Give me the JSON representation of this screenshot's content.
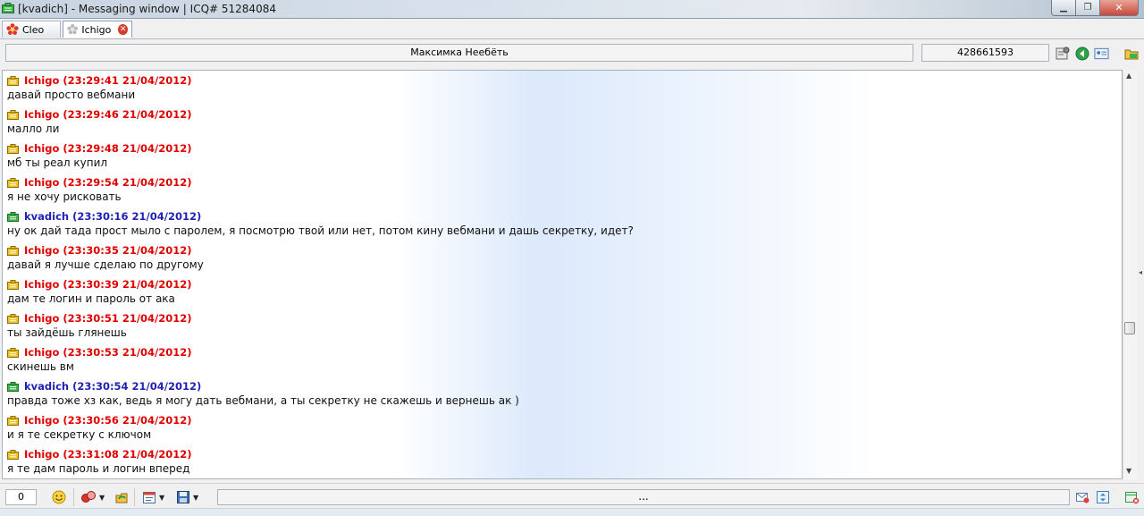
{
  "window": {
    "title": "[kvadich] - Messaging window | ICQ# 51284084",
    "minimize_glyph": "▁",
    "maximize_glyph": "❐",
    "close_glyph": "✕"
  },
  "tabs": [
    {
      "label": "Cleo",
      "icon": "flower-icon-red",
      "active": false
    },
    {
      "label": "Ichigo",
      "icon": "flower-icon-gray",
      "active": true,
      "close_icon": "close-icon"
    }
  ],
  "contact": {
    "display_name": "Максимка Неебёть",
    "uin": "428661593",
    "icons": [
      "settings-icon",
      "online-status-icon",
      "user-details-icon",
      "history-icon"
    ]
  },
  "colors": {
    "their_nick": "#e00000",
    "my_nick": "#1f22b3",
    "their_badge": "#f0c419",
    "my_badge": "#3cb34a"
  },
  "messages": [
    {
      "sender": "them",
      "header": "Ichigo (23:29:41 21/04/2012)",
      "text": "давай просто вебмани"
    },
    {
      "sender": "them",
      "header": "Ichigo (23:29:46 21/04/2012)",
      "text": "малло ли"
    },
    {
      "sender": "them",
      "header": "Ichigo (23:29:48 21/04/2012)",
      "text": "мб ты реал купил"
    },
    {
      "sender": "them",
      "header": "Ichigo (23:29:54 21/04/2012)",
      "text": "я не хочу рисковать"
    },
    {
      "sender": "me",
      "header": "kvadich (23:30:16 21/04/2012)",
      "text": "ну ок дай тада прост мыло с паролем, я посмотрю твой или нет, потом кину вебмани и дашь секретку, идет?"
    },
    {
      "sender": "them",
      "header": "Ichigo (23:30:35 21/04/2012)",
      "text": "давай я лучше сделаю по другому"
    },
    {
      "sender": "them",
      "header": "Ichigo (23:30:39 21/04/2012)",
      "text": "дам те логин и пароль от ака"
    },
    {
      "sender": "them",
      "header": "Ichigo (23:30:51 21/04/2012)",
      "text": "ты зайдёшь глянешь"
    },
    {
      "sender": "them",
      "header": "Ichigo (23:30:53 21/04/2012)",
      "text": "скинешь вм"
    },
    {
      "sender": "me",
      "header": "kvadich (23:30:54 21/04/2012)",
      "text": "правда тоже хз как, ведь я могу дать вебмани, а ты секретку не скажешь и вернешь ак )"
    },
    {
      "sender": "them",
      "header": "Ichigo (23:30:56 21/04/2012)",
      "text": "и я те секретку с ключом"
    },
    {
      "sender": "them",
      "header": "Ichigo (23:31:08 21/04/2012)",
      "text": "я те дам пароль и логин вперед"
    }
  ],
  "bottom": {
    "char_count": "0",
    "status_text": "...",
    "tools": [
      "smiley-icon",
      "nudge-icon",
      "send-file-icon",
      "calendar-icon",
      "save-icon"
    ],
    "right_icons": [
      "send-icon",
      "history-scroll-icon",
      "close-window-icon"
    ]
  }
}
